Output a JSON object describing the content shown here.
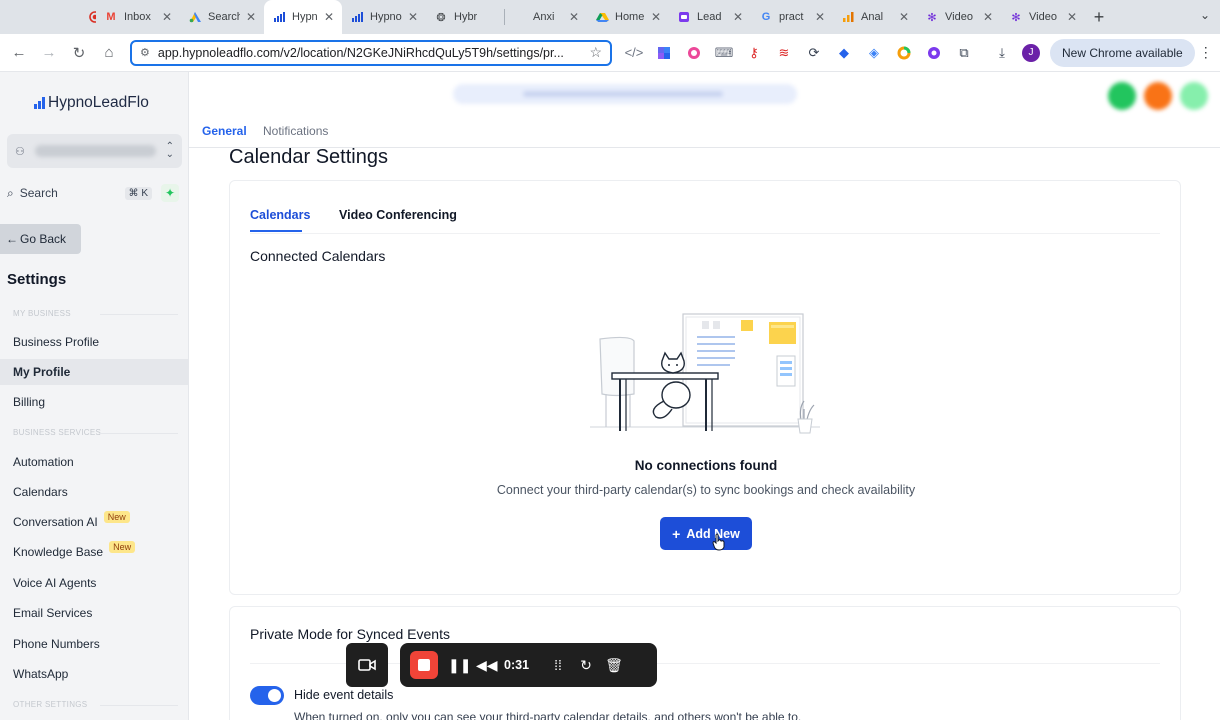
{
  "browser": {
    "tabs": [
      {
        "label": "",
        "icon": "record-icon",
        "color": "#d93025"
      },
      {
        "label": "Inbox",
        "icon": "gmail-icon",
        "color": "#ea4335"
      },
      {
        "label": "Search",
        "icon": "google-ads-icon",
        "color": "#4285f4"
      },
      {
        "label": "Hypno",
        "icon": "hypnoleadflo-icon",
        "color": "#1d4ed8",
        "active": true
      },
      {
        "label": "Hypno",
        "icon": "hypnoleadflo-icon",
        "color": "#1d4ed8"
      },
      {
        "label": "Hybr",
        "icon": "openai-icon",
        "color": "#202124"
      },
      {
        "label": "Anxi",
        "icon": "blank-icon",
        "color": "#9ca3af"
      },
      {
        "label": "Home",
        "icon": "google-drive-icon",
        "color": "#0f9d58"
      },
      {
        "label": "Lead",
        "icon": "loom-icon",
        "color": "#7c3aed"
      },
      {
        "label": "pract",
        "icon": "google-icon",
        "color": "#4285f4"
      },
      {
        "label": "Anal",
        "icon": "analytics-icon",
        "color": "#f59e0b"
      },
      {
        "label": "Video",
        "icon": "gear-flower-icon",
        "color": "#6d28d9"
      },
      {
        "label": "Video",
        "icon": "gear-flower-icon",
        "color": "#6d28d9"
      }
    ],
    "new_tab_symbol": "+",
    "tab_menu_symbol": "⌄",
    "url": "app.hypnoleadflo.com/v2/location/N2GKeJNiRhcdQuLy5T9h/settings/pr...",
    "new_chrome_label": "New Chrome available",
    "profile_initial": "J"
  },
  "sidebar": {
    "logo_text": "HypnoLeadFlo",
    "search_label": "Search",
    "search_shortcut": "⌘ K",
    "go_back_label": "Go Back",
    "settings_heading": "Settings",
    "section_my_business": "MY BUSINESS",
    "section_business_services": "BUSINESS SERVICES",
    "section_other_settings": "OTHER SETTINGS",
    "items": [
      {
        "label": "Business Profile"
      },
      {
        "label": "My Profile",
        "active": true
      },
      {
        "label": "Billing"
      },
      {
        "label": "Automation"
      },
      {
        "label": "Calendars"
      },
      {
        "label": "Conversation AI",
        "badge": "New"
      },
      {
        "label": "Knowledge Base",
        "badge": "New"
      },
      {
        "label": "Voice AI Agents"
      },
      {
        "label": "Email Services"
      },
      {
        "label": "Phone Numbers"
      },
      {
        "label": "WhatsApp"
      }
    ]
  },
  "header": {
    "subtabs": [
      "General",
      "Notifications"
    ],
    "avatar_colors": [
      "#22c55e",
      "#f97316",
      "#86efac"
    ]
  },
  "main": {
    "title": "Calendar Settings",
    "tabs": [
      "Calendars",
      "Video Conferencing"
    ],
    "connected_heading": "Connected Calendars",
    "empty_title": "No connections found",
    "empty_text": "Connect your third-party calendar(s) to sync bookings and check availability",
    "add_button": "Add New",
    "add_button_symbol": "+",
    "private_heading": "Private Mode for Synced Events",
    "toggle_label": "Hide event details",
    "toggle_on": true,
    "toggle_desc": "When turned on, only you can see your third-party calendar details, and others won't be able to."
  },
  "recorder": {
    "time": "0:31"
  },
  "colors": {
    "accent": "#2563eb",
    "button": "#1d4ed8",
    "badge_bg": "#fde68a",
    "recorder_stop": "#f04438"
  }
}
